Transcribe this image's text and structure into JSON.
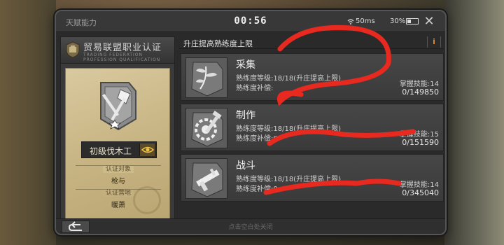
{
  "window": {
    "title": "天赋能力",
    "clock": "00:56",
    "network": "50ms",
    "battery": "30%",
    "close_symbol": "✕"
  },
  "certificate": {
    "title": "贸易联盟职业认证",
    "subtitle": "TRADING FEDERATION PROFESSION QUALIFICATION",
    "rank": "初级伐木工",
    "object_label": "认证对象",
    "object_value": "枪与",
    "location_label": "认证营地",
    "location_value": "暖萧"
  },
  "skills_panel": {
    "header": "升庄提高熟练度上限",
    "info_label": "i",
    "cards": [
      {
        "name": "采集",
        "level_text": "熟练度等级:18/18(升庄提高上限)",
        "compensation_text": "熟练度补偿:",
        "skills_text": "掌握技能:14",
        "exp_text": "0/149850",
        "icon": "gathering-icon"
      },
      {
        "name": "制作",
        "level_text": "熟练度等级:18/18(升庄提高上限)",
        "compensation_text": "熟练度补偿:0",
        "skills_text": "掌握技能:15",
        "exp_text": "0/151590",
        "icon": "crafting-icon"
      },
      {
        "name": "战斗",
        "level_text": "熟练度等级:18/18(升庄提高上限)",
        "compensation_text": "熟练度补偿:0",
        "skills_text": "掌握技能:14",
        "exp_text": "0/345040",
        "icon": "combat-icon"
      }
    ]
  },
  "footer": {
    "hint": "点击空白处关闭",
    "back_icon": "back-arrow-icon"
  },
  "colors": {
    "accent": "#e08a2a",
    "scribble": "#e8291f",
    "parchment": "#c8b584"
  }
}
